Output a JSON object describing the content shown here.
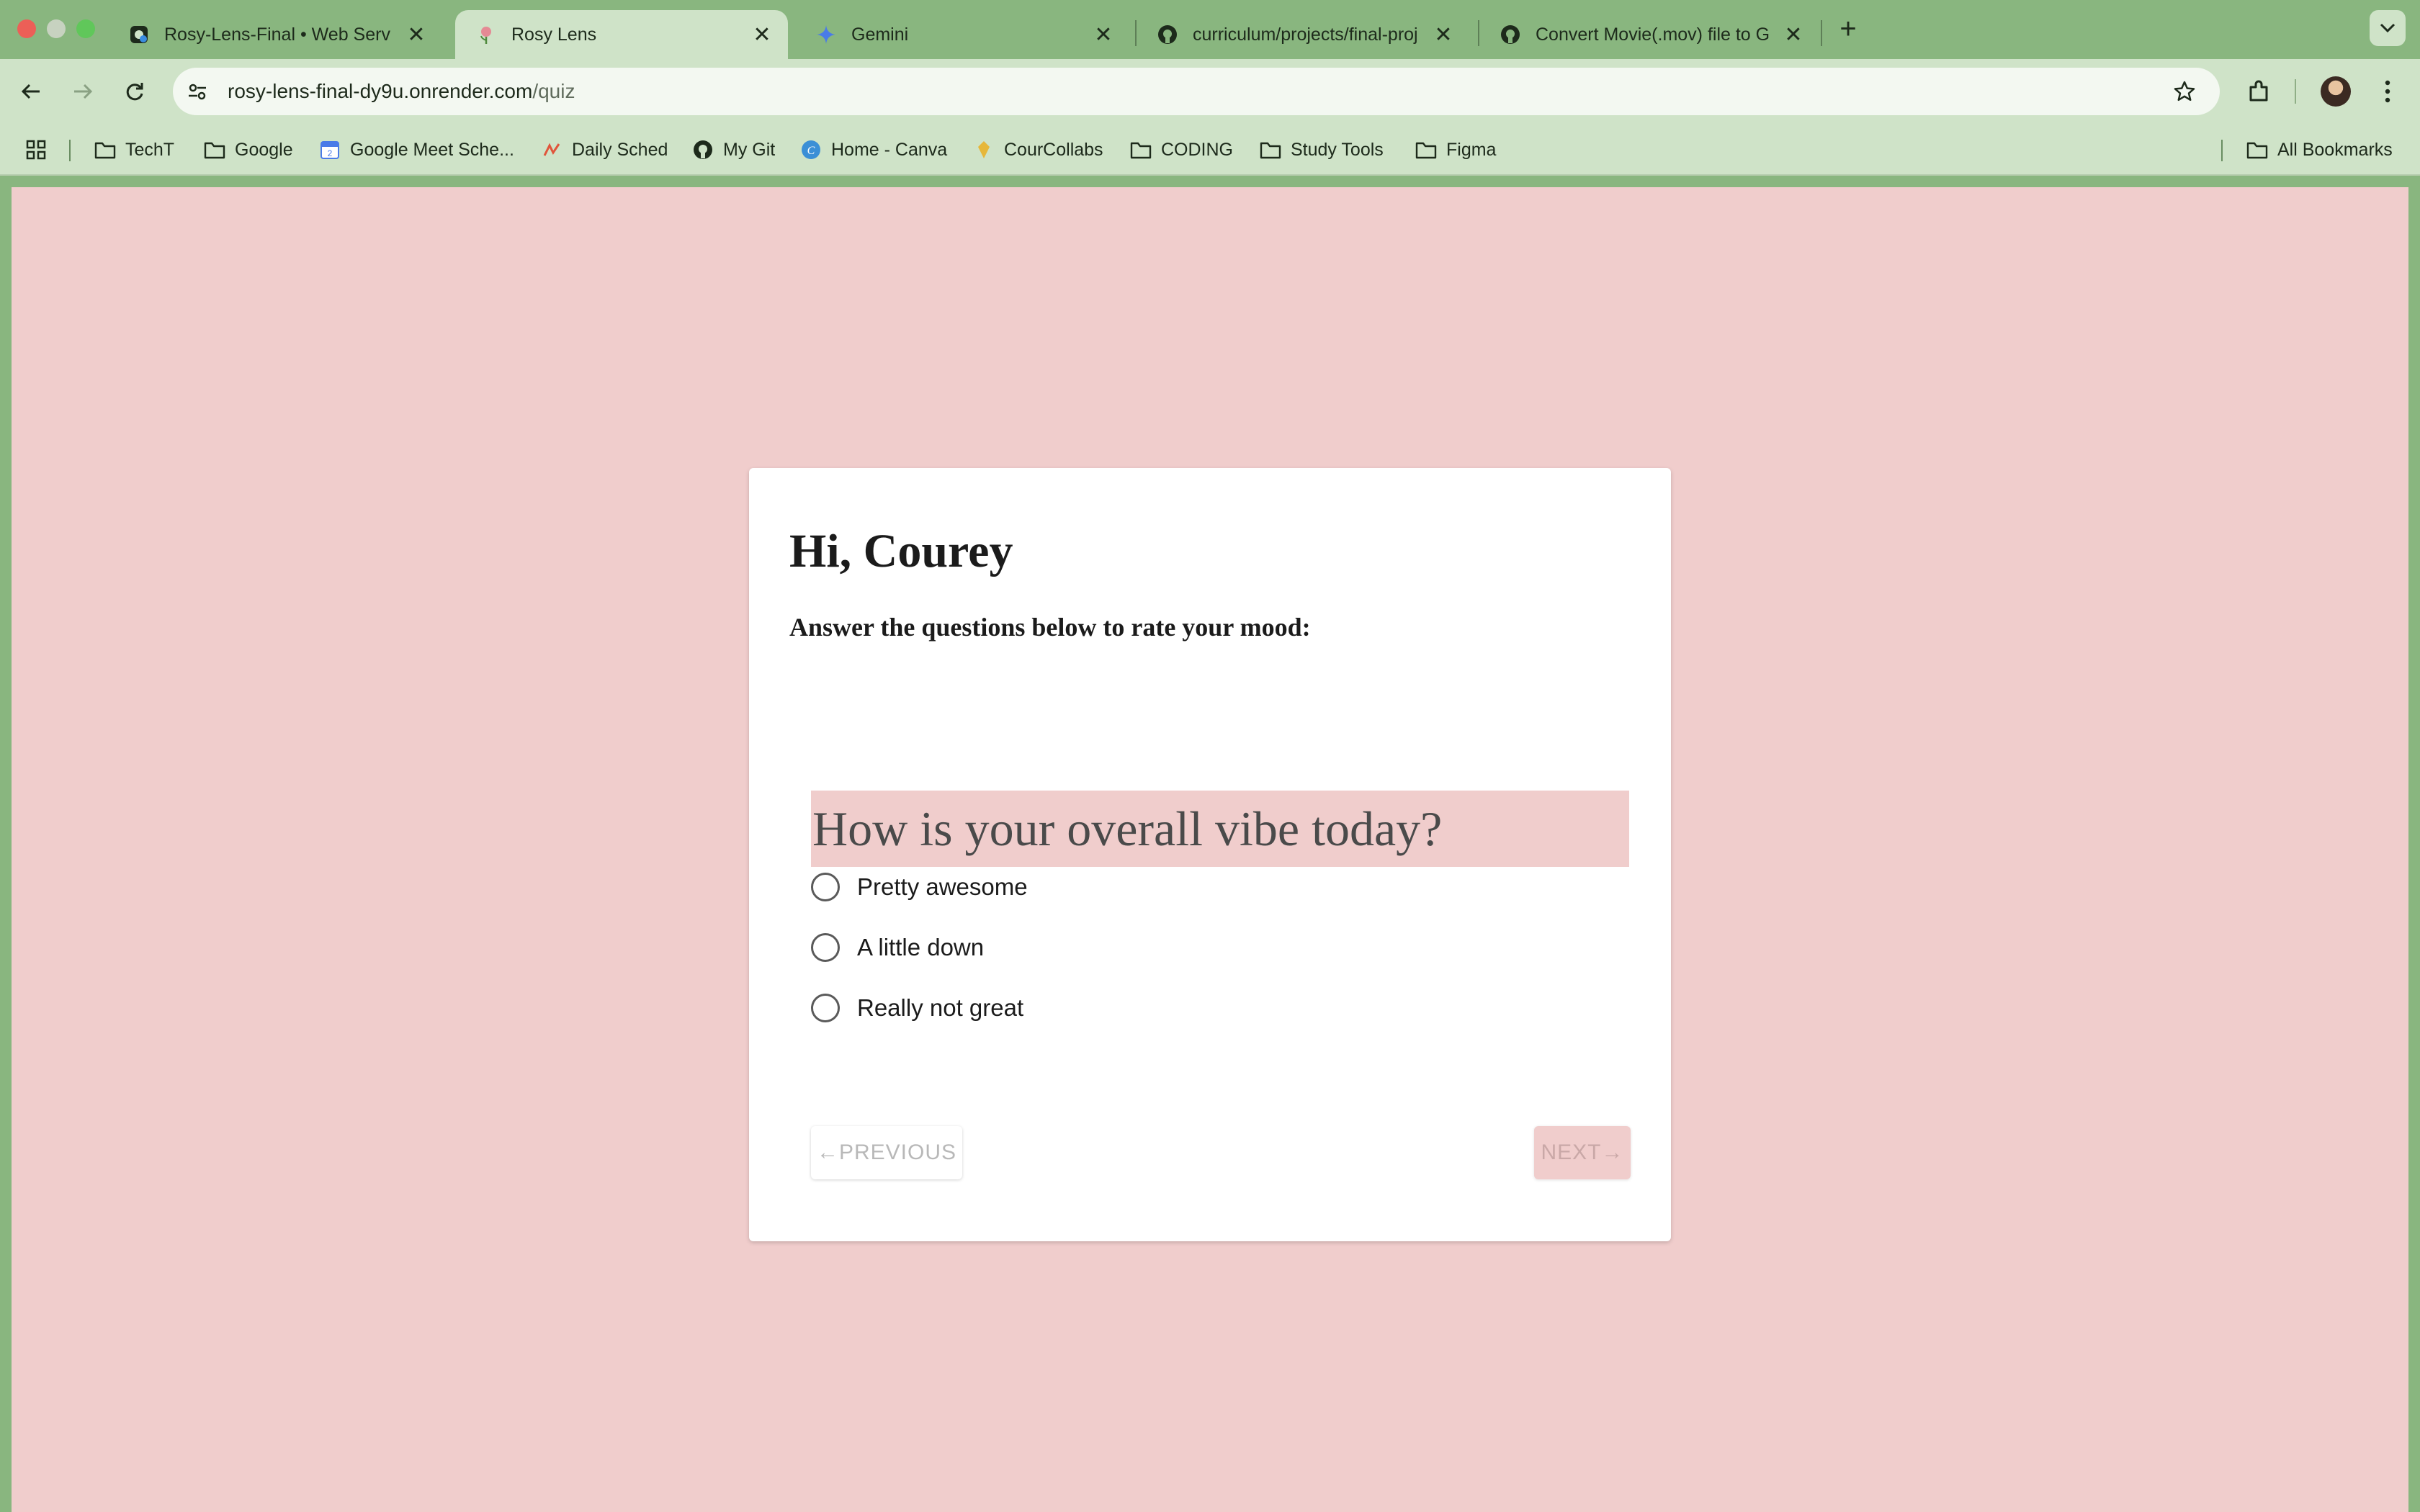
{
  "browser": {
    "tabs": [
      {
        "title": "Rosy-Lens-Final • Web Serv",
        "favicon": "render-icon",
        "active": false
      },
      {
        "title": "Rosy Lens",
        "favicon": "rose-icon",
        "active": true
      },
      {
        "title": "Gemini",
        "favicon": "gemini-sparkle-icon",
        "active": false
      },
      {
        "title": "curriculum/projects/final-proj",
        "favicon": "github-icon",
        "active": false
      },
      {
        "title": "Convert Movie(.mov) file to G",
        "favicon": "github-icon",
        "active": false
      }
    ],
    "new_tab_symbol": "+",
    "close_symbol": "✕",
    "address": {
      "host": "rosy-lens-final-dy9u.onrender.com",
      "path": "/quiz"
    },
    "bookmarks": [
      {
        "label": "TechT",
        "icon": "folder-icon"
      },
      {
        "label": "Google",
        "icon": "folder-icon"
      },
      {
        "label": "Google Meet Sche...",
        "icon": "calendar-icon"
      },
      {
        "label": "Daily Sched",
        "icon": "bookmark-site-icon"
      },
      {
        "label": "My Git",
        "icon": "github-icon"
      },
      {
        "label": "Home - Canva",
        "icon": "canva-icon"
      },
      {
        "label": "CourCollabs",
        "icon": "bookmark-site-icon"
      },
      {
        "label": "CODING",
        "icon": "folder-icon"
      },
      {
        "label": "Study Tools",
        "icon": "folder-icon"
      },
      {
        "label": "Figma",
        "icon": "folder-icon"
      }
    ],
    "all_bookmarks": "All Bookmarks"
  },
  "quiz": {
    "greeting": "Hi, Courey",
    "instruction": "Answer the questions below to rate your mood:",
    "question": "How is your overall vibe today?",
    "options": [
      "Pretty awesome",
      "A little down",
      "Really not great"
    ],
    "previous_label": "←PREVIOUS",
    "next_label": "NEXT→"
  },
  "colors": {
    "browser_frame": "#89b67f",
    "toolbar": "#cfe3c8",
    "page_background": "#f0cdcc",
    "card": "#ffffff",
    "question_highlight": "#f0cdcc"
  }
}
